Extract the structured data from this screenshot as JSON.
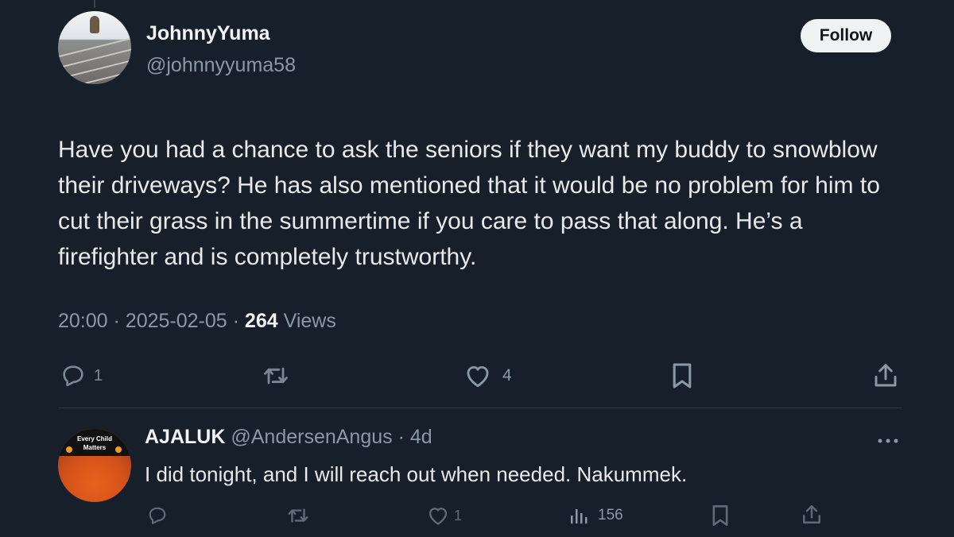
{
  "tweet": {
    "display_name": "JohnnyYuma",
    "handle": "@johnnyyuma58",
    "follow_label": "Follow",
    "text": "Have you had a chance to ask the seniors if they want my buddy to snowblow their driveways? He has also mentioned that it would be no problem for him to cut their grass in the summertime if you care to pass that along. He’s a firefighter and is completely trustworthy.",
    "time": "20:00",
    "sep": "·",
    "date": "2025-02-05",
    "views_count": "264",
    "views_label": "Views",
    "actions": {
      "reply_count": "1",
      "like_count": "4"
    }
  },
  "reply": {
    "display_name": "AJALUK",
    "handle": "@AndersenAngus",
    "sep": "·",
    "age": "4d",
    "text": "I did tonight, and I will reach out when needed. Nakummek.",
    "avatar_text_line1": "Every Child",
    "avatar_text_line2": "Matters",
    "actions": {
      "like_count": "1",
      "views_count": "156"
    }
  },
  "icons": {
    "reply": "speech-bubble-icon",
    "retweet": "retweet-icon",
    "like": "heart-icon",
    "bookmark": "bookmark-icon",
    "share": "share-icon",
    "views": "bar-chart-icon",
    "more": "more-horizontal-icon"
  },
  "colors": {
    "background": "#17202a",
    "text_primary": "#e7e9ea",
    "text_secondary": "#8b98a5",
    "follow_bg": "#eff3f4"
  }
}
